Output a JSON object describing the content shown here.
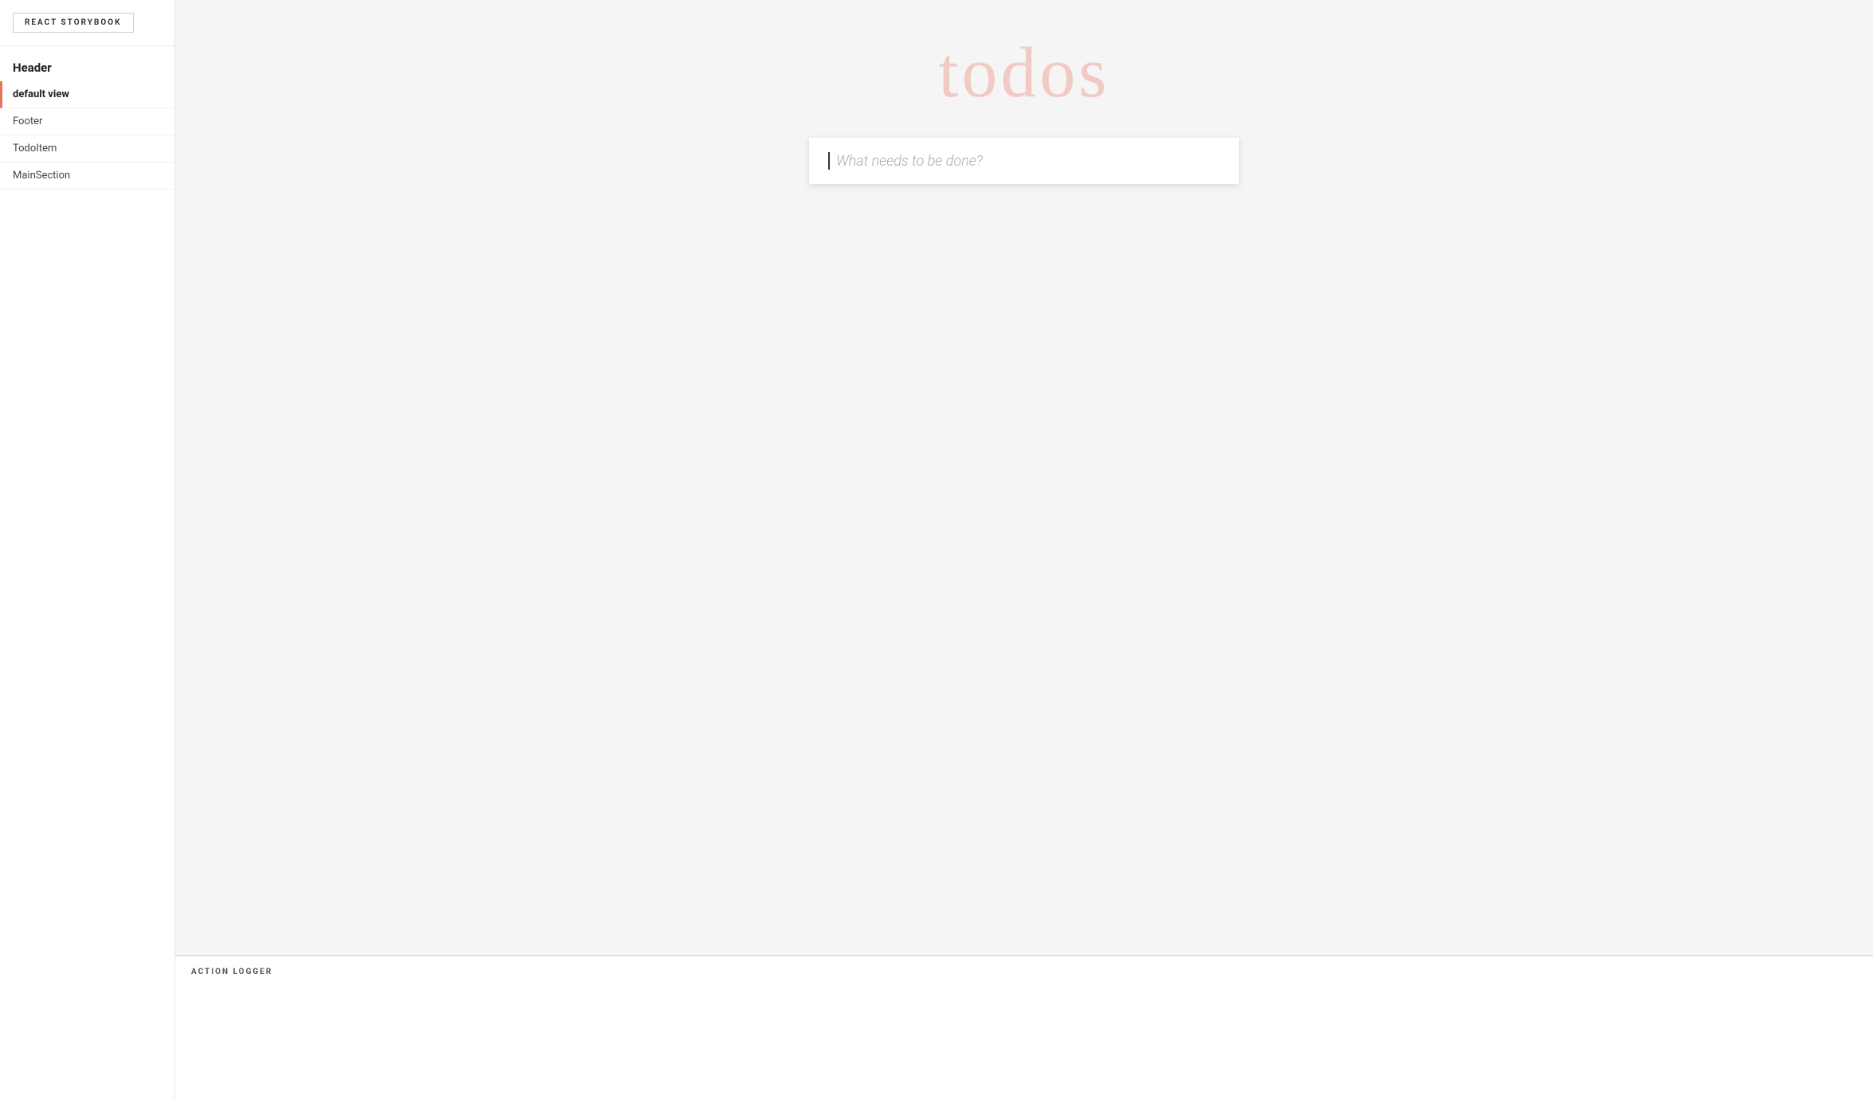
{
  "sidebar": {
    "logo_label": "REACT STORYBOOK",
    "section_header": "Header",
    "items": [
      {
        "id": "default-view",
        "label": "default view",
        "active": true
      },
      {
        "id": "footer",
        "label": "Footer",
        "active": false
      },
      {
        "id": "todo-item",
        "label": "TodoItem",
        "active": false
      },
      {
        "id": "main-section",
        "label": "MainSection",
        "active": false
      }
    ]
  },
  "preview": {
    "todos_title": "todos",
    "input_placeholder": "What needs to be done?"
  },
  "action_logger": {
    "title": "ACTION LOGGER"
  }
}
